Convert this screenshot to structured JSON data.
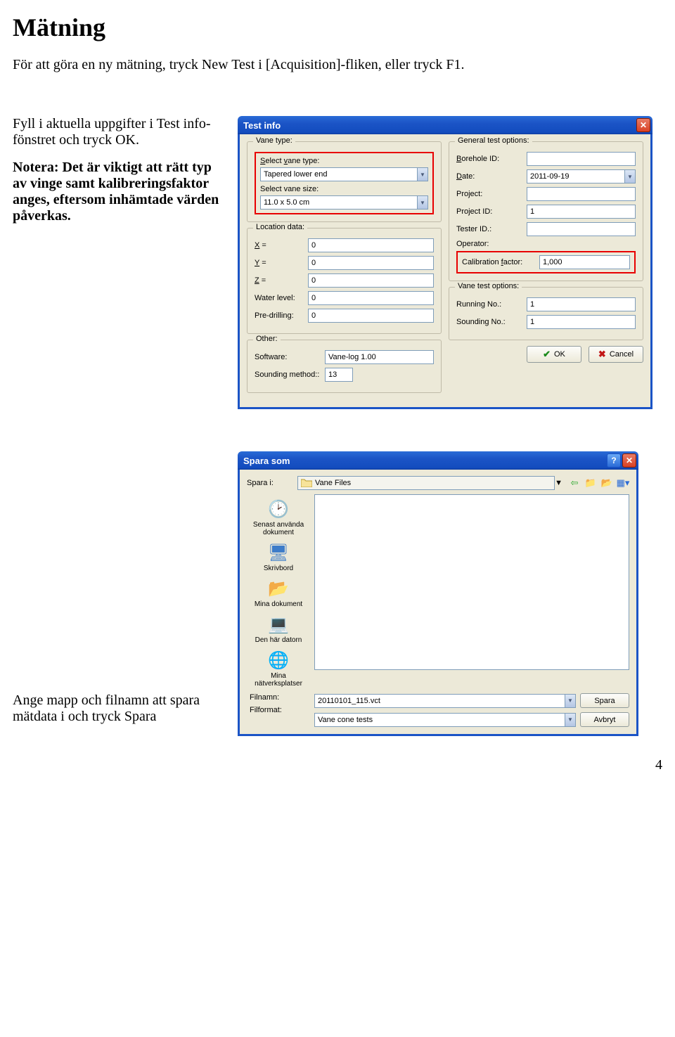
{
  "page": {
    "title": "Mätning",
    "intro": "För att göra en ny mätning, tryck New Test i [Acquisition]-fliken, eller tryck F1.",
    "fill_text": "Fyll i aktuella uppgifter i Test info-fönstret och tryck OK.",
    "note_text": "Notera: Det är viktigt att rätt typ av vinge samt kalibreringsfaktor anges, eftersom inhämtade värden påverkas.",
    "savetext": "Ange mapp och filnamn att spara mätdata i och tryck Spara",
    "number": "4"
  },
  "testinfo": {
    "title": "Test info",
    "vanetype": {
      "legend": "Vane type:",
      "select_type_label": "Select vane type:",
      "select_type_value": "Tapered lower end",
      "select_size_label": "Select vane size:",
      "select_size_value": "11.0 x 5.0 cm"
    },
    "general": {
      "legend": "General test options:",
      "borehole_label": "Borehole ID:",
      "borehole_value": "",
      "date_label": "Date:",
      "date_value": "2011-09-19",
      "project_label": "Project:",
      "project_value": "",
      "projectid_label": "Project ID:",
      "projectid_value": "1",
      "testerid_label": "Tester ID.:",
      "testerid_value": "",
      "operator_label": "Operator:",
      "calib_label": "Calibration factor:",
      "calib_value": "1,000"
    },
    "location": {
      "legend": "Location data:",
      "x_label": "X =",
      "x_value": "0",
      "y_label": "Y =",
      "y_value": "0",
      "z_label": "Z =",
      "z_value": "0",
      "water_label": "Water level:",
      "water_value": "0",
      "predrill_label": "Pre-drilling:",
      "predrill_value": "0"
    },
    "vaneopt": {
      "legend": "Vane test options:",
      "running_label": "Running No.:",
      "running_value": "1",
      "sounding_label": "Sounding No.:",
      "sounding_value": "1"
    },
    "other": {
      "legend": "Other:",
      "software_label": "Software:",
      "software_value": "Vane-log 1.00",
      "sounding_label": "Sounding method::",
      "sounding_value": "13"
    },
    "ok_label": "OK",
    "cancel_label": "Cancel"
  },
  "save": {
    "title": "Spara som",
    "savein_label": "Spara i:",
    "folder": "Vane Files",
    "places": {
      "recent": "Senast använda dokument",
      "desktop": "Skrivbord",
      "mydocs": "Mina dokument",
      "mycomputer": "Den här datorn",
      "network": "Mina nätverksplatser"
    },
    "filename_label": "Filnamn:",
    "filename_value": "20110101_115.vct",
    "filetype_label": "Filformat:",
    "filetype_value": "Vane cone tests",
    "save_btn": "Spara",
    "cancel_btn": "Avbryt"
  }
}
